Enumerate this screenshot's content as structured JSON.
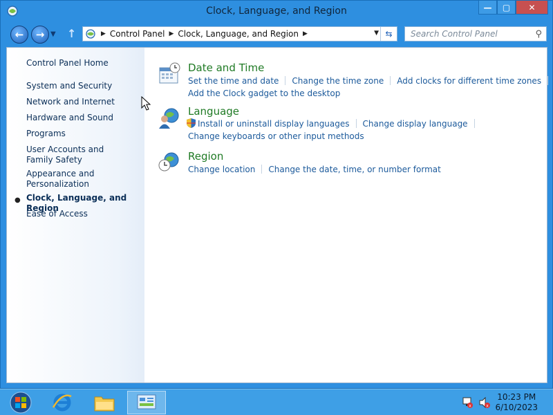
{
  "window": {
    "title": "Clock, Language, and Region",
    "caption_buttons": {
      "minimize": "—",
      "maximize": "▢",
      "close": "✕"
    }
  },
  "navbar": {
    "breadcrumb": [
      "Control Panel",
      "Clock, Language, and Region"
    ],
    "search_placeholder": "Search Control Panel"
  },
  "sidebar": {
    "home": "Control Panel Home",
    "items": [
      {
        "label": "System and Security",
        "active": false
      },
      {
        "label": "Network and Internet",
        "active": false
      },
      {
        "label": "Hardware and Sound",
        "active": false
      },
      {
        "label": "Programs",
        "active": false
      },
      {
        "label": "User Accounts and Family Safety",
        "active": false
      },
      {
        "label": "Appearance and Personalization",
        "active": false
      },
      {
        "label": "Clock, Language, and Region",
        "active": true
      },
      {
        "label": "Ease of Access",
        "active": false
      }
    ],
    "bullet": "●"
  },
  "categories": [
    {
      "title": "Date and Time",
      "icon": "calendar-clock-icon",
      "links": [
        "Set the time and date",
        "Change the time zone",
        "Add clocks for different time zones",
        "Add the Clock gadget to the desktop"
      ]
    },
    {
      "title": "Language",
      "icon": "globe-people-icon",
      "links": [
        "Install or uninstall display languages",
        "Change display language",
        "Change keyboards or other input methods"
      ]
    },
    {
      "title": "Region",
      "icon": "globe-clock-icon",
      "links": [
        "Change location",
        "Change the date, time, or number format"
      ]
    }
  ],
  "taskbar": {
    "time": "10:23 PM",
    "date": "6/10/2023"
  },
  "colors": {
    "title_bar": "#2e8fe0",
    "link": "#1c5a9b",
    "category_title": "#1f7a24",
    "taskbar": "#3e9fe6"
  }
}
